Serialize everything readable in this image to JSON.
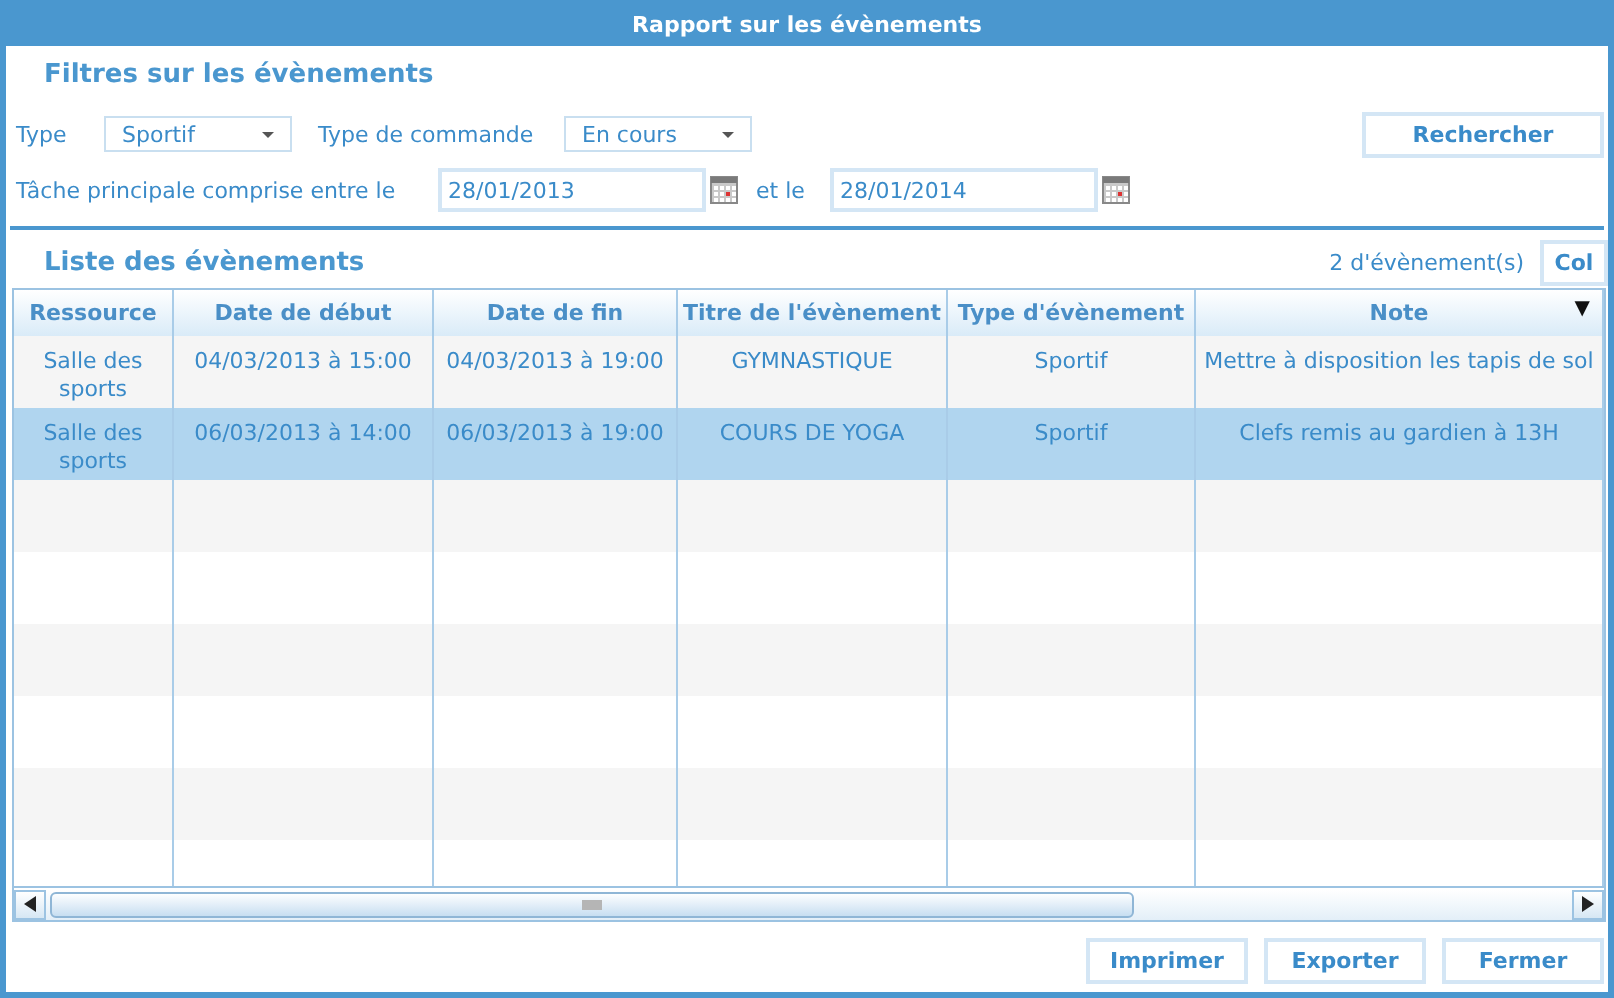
{
  "window": {
    "title": "Rapport sur les évènements"
  },
  "filters": {
    "heading": "Filtres sur les évènements",
    "type_label": "Type",
    "type_value": "Sportif",
    "order_label": "Type de commande",
    "order_value": "En cours",
    "search_button": "Rechercher",
    "range_label": "Tâche principale comprise entre le",
    "start_date": "28/01/2013",
    "and_label": "et le",
    "end_date": "28/01/2014"
  },
  "list": {
    "heading": "Liste des évènements",
    "count": "2 d'évènement(s)",
    "columns_button": "Col"
  },
  "table": {
    "columns": [
      "Ressource",
      "Date de début",
      "Date de fin",
      "Titre de l'évènement",
      "Type d'évènement",
      "Note"
    ],
    "sort_indicator": "▼",
    "rows": [
      {
        "selected": false,
        "cells": [
          "Salle des sports",
          "04/03/2013 à 15:00",
          "04/03/2013 à 19:00",
          "GYMNASTIQUE",
          "Sportif",
          "Mettre à disposition les tapis de sol"
        ]
      },
      {
        "selected": true,
        "cells": [
          "Salle des sports",
          "06/03/2013 à 14:00",
          "06/03/2013 à 19:00",
          "COURS DE YOGA",
          "Sportif",
          "Clefs remis au gardien à 13H"
        ]
      }
    ]
  },
  "buttons": [
    "Imprimer",
    "Exporter",
    "Fermer"
  ]
}
